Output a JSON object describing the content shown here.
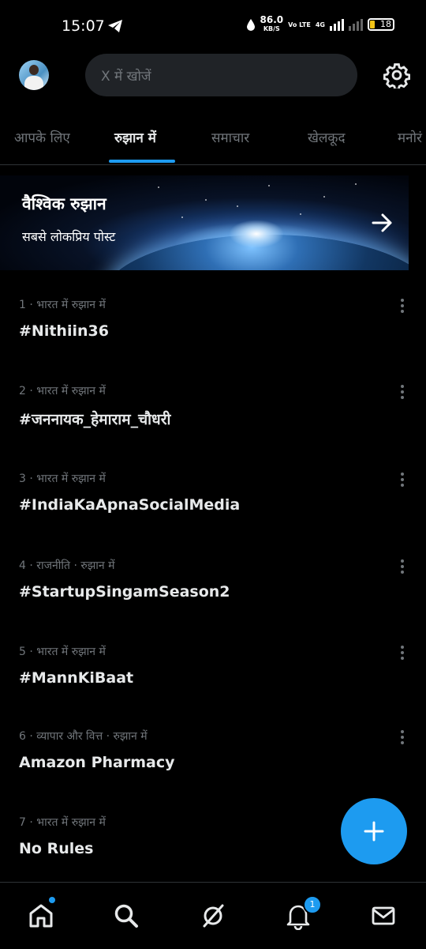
{
  "status_bar": {
    "time": "15:07",
    "net_speed": "86.0",
    "net_unit": "KB/S",
    "volte": "Vo LTE",
    "network": "4G",
    "battery": "18"
  },
  "header": {
    "search_placeholder": "X में खोजें"
  },
  "tabs": [
    {
      "label": "आपके लिए",
      "active": false
    },
    {
      "label": "रुझान में",
      "active": true
    },
    {
      "label": "समाचार",
      "active": false
    },
    {
      "label": "खेलकूद",
      "active": false
    },
    {
      "label": "मनोरं",
      "active": false
    }
  ],
  "banner": {
    "title": "वैश्विक रुझान",
    "subtitle": "सबसे लोकप्रिय पोस्ट"
  },
  "trends": [
    {
      "meta": "1 · भारत में रुझान में",
      "name": "#Nithiin36"
    },
    {
      "meta": "2 · भारत में रुझान में",
      "name": "#जननायक_हेमाराम_चौधरी"
    },
    {
      "meta": "3 · भारत में रुझान में",
      "name": "#IndiaKaApnaSocialMedia"
    },
    {
      "meta": "4 · राजनीति · रुझान में",
      "name": "#StartupSingamSeason2"
    },
    {
      "meta": "5 · भारत में रुझान में",
      "name": "#MannKiBaat"
    },
    {
      "meta": "6 · व्यापार और वित्त · रुझान में",
      "name": "Amazon Pharmacy"
    },
    {
      "meta": "7 · भारत में रुझान में",
      "name": "No Rules"
    }
  ],
  "bottom_nav": {
    "items": [
      "home-icon",
      "search-icon",
      "grok-icon",
      "notifications-icon",
      "messages-icon"
    ],
    "notification_count": "1"
  },
  "colors": {
    "accent": "#1d9bf0",
    "background": "#000000",
    "text_primary": "#e7e9ea",
    "text_secondary": "#71767b"
  }
}
